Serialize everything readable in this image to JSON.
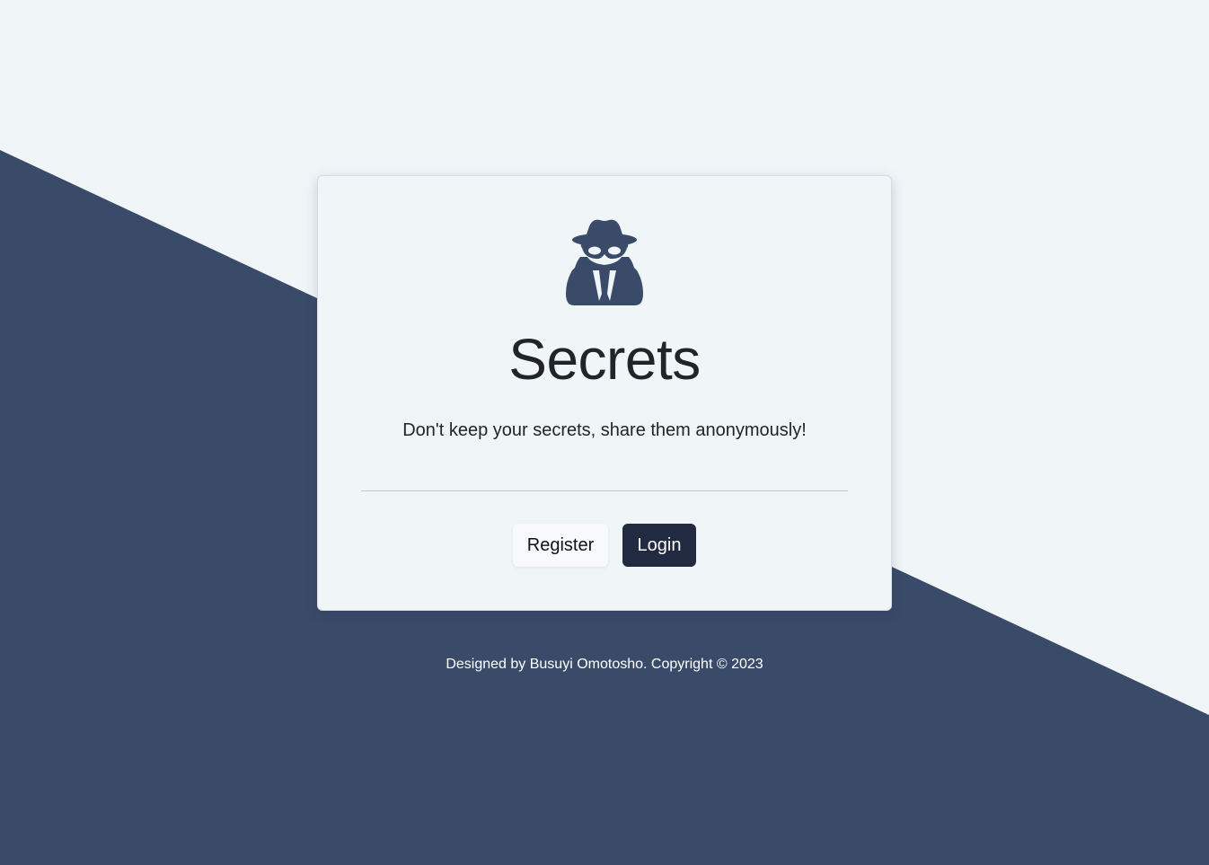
{
  "colors": {
    "page_background": "#f0f5f8",
    "diagonal_band": "#3a4a69",
    "card_background": "#f0f5f8",
    "logo": "#3a4a69",
    "heading_text": "#212529",
    "divider": "#c2c8ce",
    "register_bg": "#f8f9fa",
    "register_text": "#111111",
    "login_bg": "#212a40",
    "login_text": "#ffffff",
    "footer_text": "#ffffff"
  },
  "logo": {
    "icon": "user-secret-icon"
  },
  "hero": {
    "title": "Secrets",
    "tagline": "Don't keep your secrets, share them anonymously!"
  },
  "actions": {
    "register_label": "Register",
    "login_label": "Login"
  },
  "footer": {
    "text": "Designed by Busuyi Omotosho. Copyright © 2023"
  }
}
